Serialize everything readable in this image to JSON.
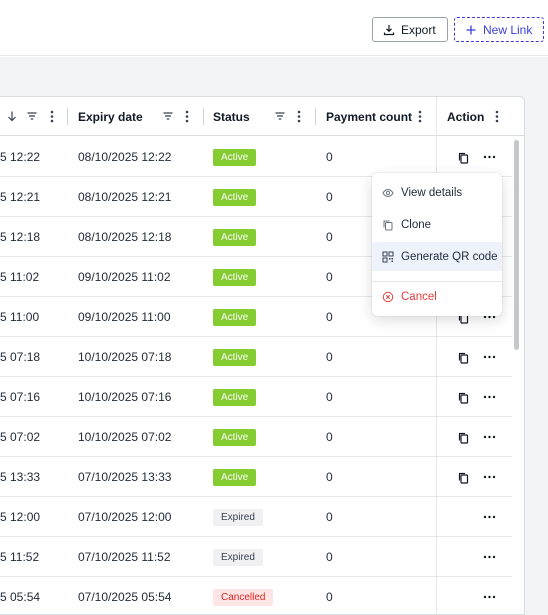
{
  "toolbar": {
    "export_label": "Export",
    "new_link_label": "New Link"
  },
  "table": {
    "columns": {
      "created": "",
      "expiry": "Expiry date",
      "status": "Status",
      "payment_count": "Payment count",
      "action": "Action"
    },
    "rows": [
      {
        "created": "5 12:22",
        "expiry": "08/10/2025 12:22",
        "status": "Active",
        "count": "0",
        "clone_icon": true
      },
      {
        "created": "5 12:21",
        "expiry": "08/10/2025 12:21",
        "status": "Active",
        "count": "0",
        "clone_icon": true
      },
      {
        "created": "5 12:18",
        "expiry": "08/10/2025 12:18",
        "status": "Active",
        "count": "0",
        "clone_icon": true
      },
      {
        "created": "5 11:02",
        "expiry": "09/10/2025 11:02",
        "status": "Active",
        "count": "0",
        "clone_icon": true
      },
      {
        "created": "5 11:00",
        "expiry": "09/10/2025 11:00",
        "status": "Active",
        "count": "0",
        "clone_icon": true
      },
      {
        "created": "5 07:18",
        "expiry": "10/10/2025 07:18",
        "status": "Active",
        "count": "0",
        "clone_icon": true
      },
      {
        "created": "5 07:16",
        "expiry": "10/10/2025 07:16",
        "status": "Active",
        "count": "0",
        "clone_icon": true
      },
      {
        "created": "5 07:02",
        "expiry": "10/10/2025 07:02",
        "status": "Active",
        "count": "0",
        "clone_icon": true
      },
      {
        "created": "5 13:33",
        "expiry": "07/10/2025 13:33",
        "status": "Active",
        "count": "0",
        "clone_icon": true
      },
      {
        "created": "5 12:00",
        "expiry": "07/10/2025 12:00",
        "status": "Expired",
        "count": "0",
        "clone_icon": false
      },
      {
        "created": "5 11:52",
        "expiry": "07/10/2025 11:52",
        "status": "Expired",
        "count": "0",
        "clone_icon": false
      },
      {
        "created": "5 05:54",
        "expiry": "07/10/2025 05:54",
        "status": "Cancelled",
        "count": "0",
        "clone_icon": false
      }
    ]
  },
  "menu": {
    "view_details": "View details",
    "clone": "Clone",
    "generate_qr": "Generate QR code",
    "cancel": "Cancel"
  },
  "colors": {
    "accent": "#3b3fd8",
    "active": "#84cc30",
    "cancelled": "#dc2626"
  }
}
